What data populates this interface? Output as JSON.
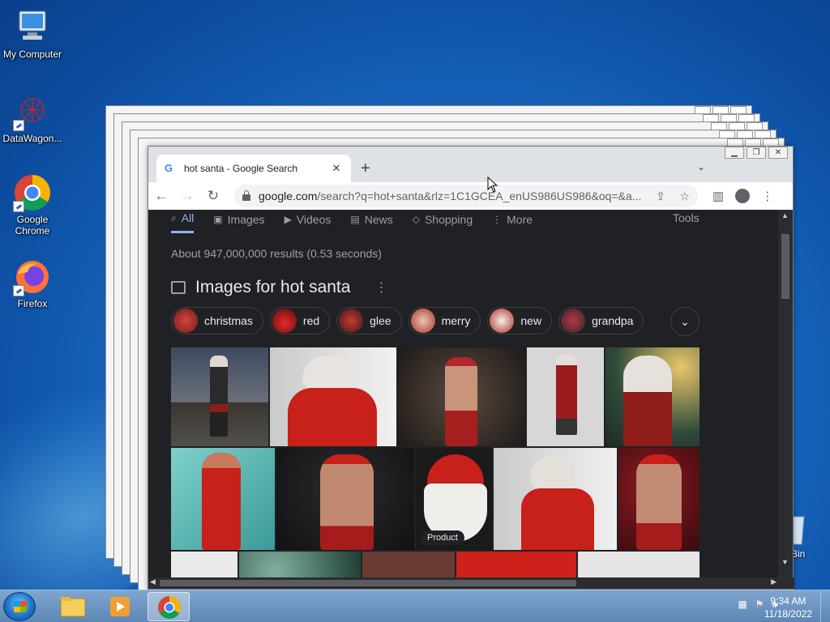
{
  "desktop": {
    "icons": [
      {
        "label": "My Computer"
      },
      {
        "label": "DataWagon..."
      },
      {
        "label": "Google Chrome"
      },
      {
        "label": "Firefox"
      }
    ],
    "recycle_label": "e Bin"
  },
  "browser": {
    "tab_title": "hot santa - Google Search",
    "tab_close": "✕",
    "new_tab": "+",
    "url_host": "google.com",
    "url_rest": "/search?q=hot+santa&rlz=1C1GCEA_enUS986US986&oq=&a...",
    "window_controls": [
      "▁",
      "❐",
      "✕"
    ]
  },
  "search": {
    "tabs": [
      {
        "label": "All",
        "icon": "search-icon"
      },
      {
        "label": "Images",
        "icon": "image-icon"
      },
      {
        "label": "Videos",
        "icon": "video-icon"
      },
      {
        "label": "News",
        "icon": "news-icon"
      },
      {
        "label": "Shopping",
        "icon": "tag-icon"
      },
      {
        "label": "More",
        "icon": "more-vert-icon"
      }
    ],
    "tools": "Tools",
    "results_stats": "About 947,000,000 results (0.53 seconds)",
    "images_heading": "Images for hot santa",
    "chips": [
      {
        "label": "christmas"
      },
      {
        "label": "red"
      },
      {
        "label": "glee"
      },
      {
        "label": "merry"
      },
      {
        "label": "new"
      },
      {
        "label": "grandpa"
      }
    ],
    "product_badge": "Product"
  },
  "taskbar": {
    "time": "9:34 AM",
    "date": "11/18/2022"
  },
  "colors": {
    "accent": "#8ab4f8",
    "page_bg": "#202124",
    "santa_red": "#c0231f"
  }
}
